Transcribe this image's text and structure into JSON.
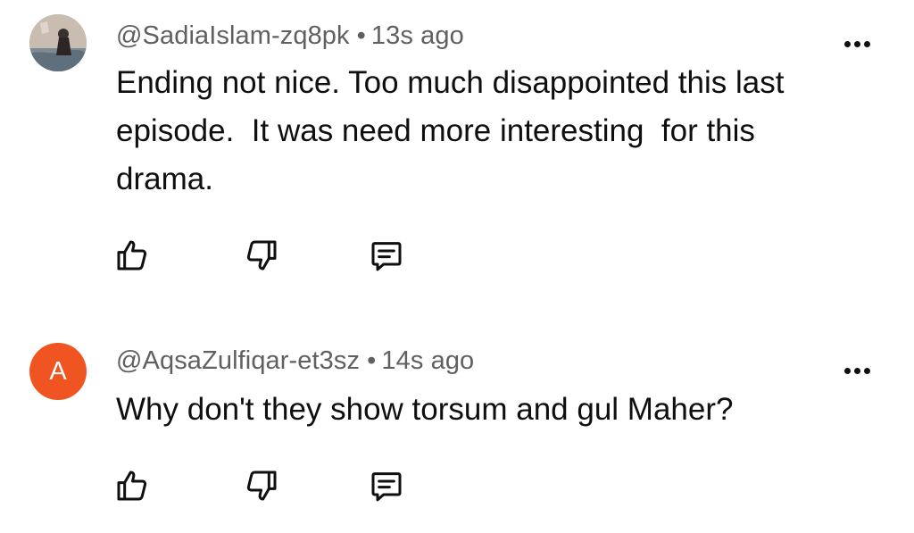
{
  "comments": [
    {
      "author": "@SadiaIslam-zq8pk",
      "separator": "•",
      "time": "13s ago",
      "text": "Ending not nice. Too much disappointed this last episode.  It was need more interesting  for this drama.",
      "avatar": "photo",
      "actions": [
        "like-icon",
        "dislike-icon",
        "reply-icon"
      ]
    },
    {
      "author": "@AqsaZulfiqar-et3sz",
      "separator": "•",
      "time": "14s ago",
      "text": "Why don't they show torsum and gul Maher?",
      "avatar_letter": "A",
      "avatar_color": "#ef5421",
      "actions": [
        "like-icon",
        "dislike-icon",
        "reply-icon"
      ]
    }
  ],
  "menu_icon": "more-vertical-dots-icon"
}
